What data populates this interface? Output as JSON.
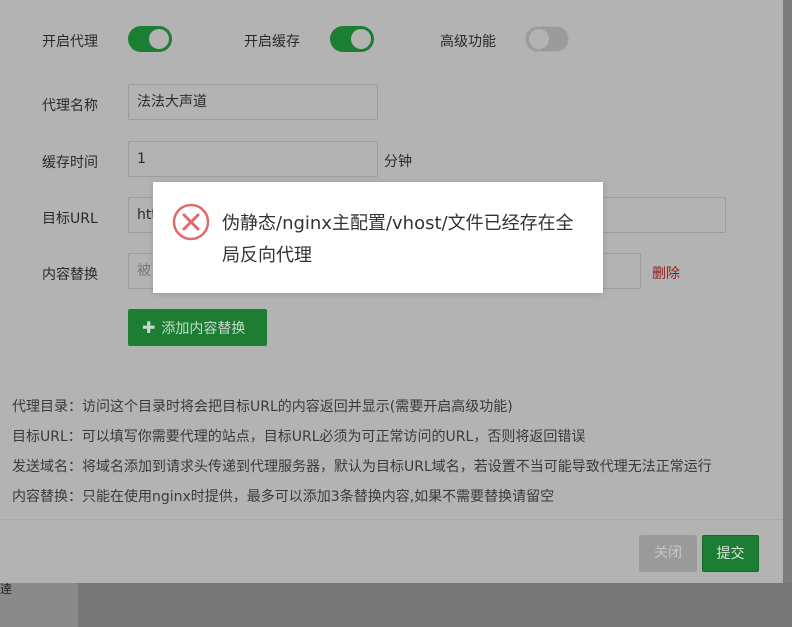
{
  "form": {
    "proxy_toggle_label": "开启代理",
    "proxy_toggle_on": true,
    "cache_toggle_label": "开启缓存",
    "cache_toggle_on": true,
    "advanced_toggle_label": "高级功能",
    "advanced_toggle_on": false,
    "proxy_name_label": "代理名称",
    "proxy_name_value": "法法大声道",
    "cache_time_label": "缓存时间",
    "cache_time_value": "1",
    "cache_time_unit": "分钟",
    "target_url_label": "目标URL",
    "target_url_value": "htt",
    "replace_label": "内容替换",
    "replace_placeholder": "被",
    "delete_link": "删除",
    "add_replace_button": "添加内容替换"
  },
  "help": [
    "代理目录：访问这个目录时将会把目标URL的内容返回并显示(需要开启高级功能)",
    "目标URL：可以填写你需要代理的站点，目标URL必须为可正常访问的URL，否则将返回错误",
    "发送域名：将域名添加到请求头传递到代理服务器，默认为目标URL域名，若设置不当可能导致代理无法正常运行",
    "内容替换：只能在使用nginx时提供，最多可以添加3条替换内容,如果不需要替换请留空"
  ],
  "footer": {
    "close_button": "关闭",
    "submit_button": "提交"
  },
  "message": {
    "icon": "error-circle-icon",
    "text": "伪静态/nginx主配置/vhost/文件已经存在全局反向代理",
    "icon_color": "#e06a6a"
  },
  "background": {
    "side_text": "逹"
  },
  "colors": {
    "accent_green": "#1c7e32",
    "danger": "#8f1d1d"
  }
}
